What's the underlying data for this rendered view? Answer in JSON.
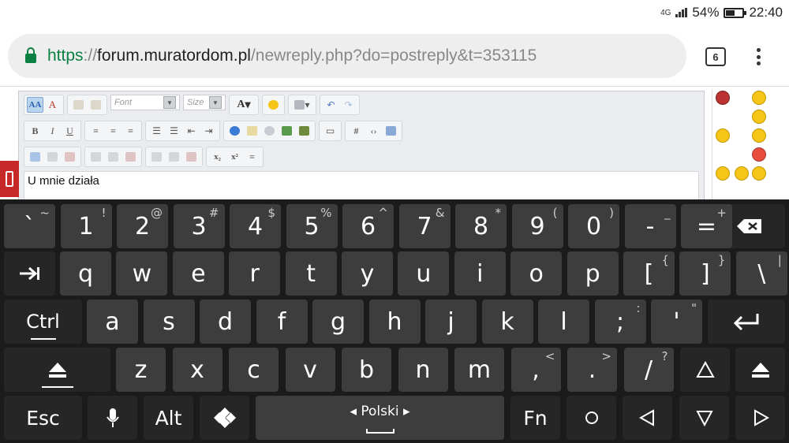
{
  "status_bar": {
    "network": "4G",
    "battery_text": "54%",
    "battery_level": 0.54,
    "time": "22:40"
  },
  "browser": {
    "url": {
      "scheme": "https",
      "sep": "://",
      "host": "forum.muratordom.pl",
      "path": "/newreply.php?do=postreply&t=353115"
    },
    "tabs_count": "6"
  },
  "editor": {
    "font_select": "Font",
    "size_select": "Size",
    "font_color_label": "A",
    "text_value": "U mnie działa"
  },
  "keyboard": {
    "row1": [
      {
        "main": "`",
        "sub": "~"
      },
      {
        "main": "1",
        "sub": "!"
      },
      {
        "main": "2",
        "sub": "@"
      },
      {
        "main": "3",
        "sub": "#"
      },
      {
        "main": "4",
        "sub": "$"
      },
      {
        "main": "5",
        "sub": "%"
      },
      {
        "main": "6",
        "sub": "^"
      },
      {
        "main": "7",
        "sub": "&"
      },
      {
        "main": "8",
        "sub": "*"
      },
      {
        "main": "9",
        "sub": "("
      },
      {
        "main": "0",
        "sub": ")"
      },
      {
        "main": "-",
        "sub": "_"
      },
      {
        "main": "=",
        "sub": "+"
      }
    ],
    "row2": [
      {
        "main": "q"
      },
      {
        "main": "w"
      },
      {
        "main": "e"
      },
      {
        "main": "r"
      },
      {
        "main": "t"
      },
      {
        "main": "y"
      },
      {
        "main": "u"
      },
      {
        "main": "i"
      },
      {
        "main": "o"
      },
      {
        "main": "p"
      },
      {
        "main": "[",
        "sub": "{"
      },
      {
        "main": "]",
        "sub": "}"
      },
      {
        "main": "\\",
        "sub": "|"
      }
    ],
    "row3": [
      {
        "main": "a"
      },
      {
        "main": "s"
      },
      {
        "main": "d"
      },
      {
        "main": "f"
      },
      {
        "main": "g"
      },
      {
        "main": "h"
      },
      {
        "main": "j"
      },
      {
        "main": "k"
      },
      {
        "main": "l"
      },
      {
        "main": ";",
        "sub": ":"
      },
      {
        "main": "'",
        "sub": "\""
      }
    ],
    "row4": [
      {
        "main": "z"
      },
      {
        "main": "x"
      },
      {
        "main": "c"
      },
      {
        "main": "v"
      },
      {
        "main": "b"
      },
      {
        "main": "n"
      },
      {
        "main": "m"
      },
      {
        "main": ",",
        "sub": "<"
      },
      {
        "main": ".",
        "sub": ">"
      },
      {
        "main": "/",
        "sub": "?"
      }
    ],
    "ctrl_label": "Ctrl",
    "esc_label": "Esc",
    "alt_label": "Alt",
    "language_label": "Polski",
    "fn_label": "Fn"
  },
  "icons": {
    "backspace": "backspace-icon",
    "tab": "tab-icon",
    "enter": "enter-icon",
    "shift": "shift-icon",
    "mic": "mic-icon",
    "dpad": "dpad-icon",
    "up": "arrow-up-icon",
    "home": "home-circle-icon",
    "back": "nav-back-icon",
    "recents": "nav-down-icon",
    "forward": "nav-forward-icon"
  },
  "colors": {
    "url_secure": "#0b8043",
    "keyboard_bg": "#1b1b1b",
    "key_bg": "#3d3d3d",
    "phone_tab": "#c62828"
  }
}
